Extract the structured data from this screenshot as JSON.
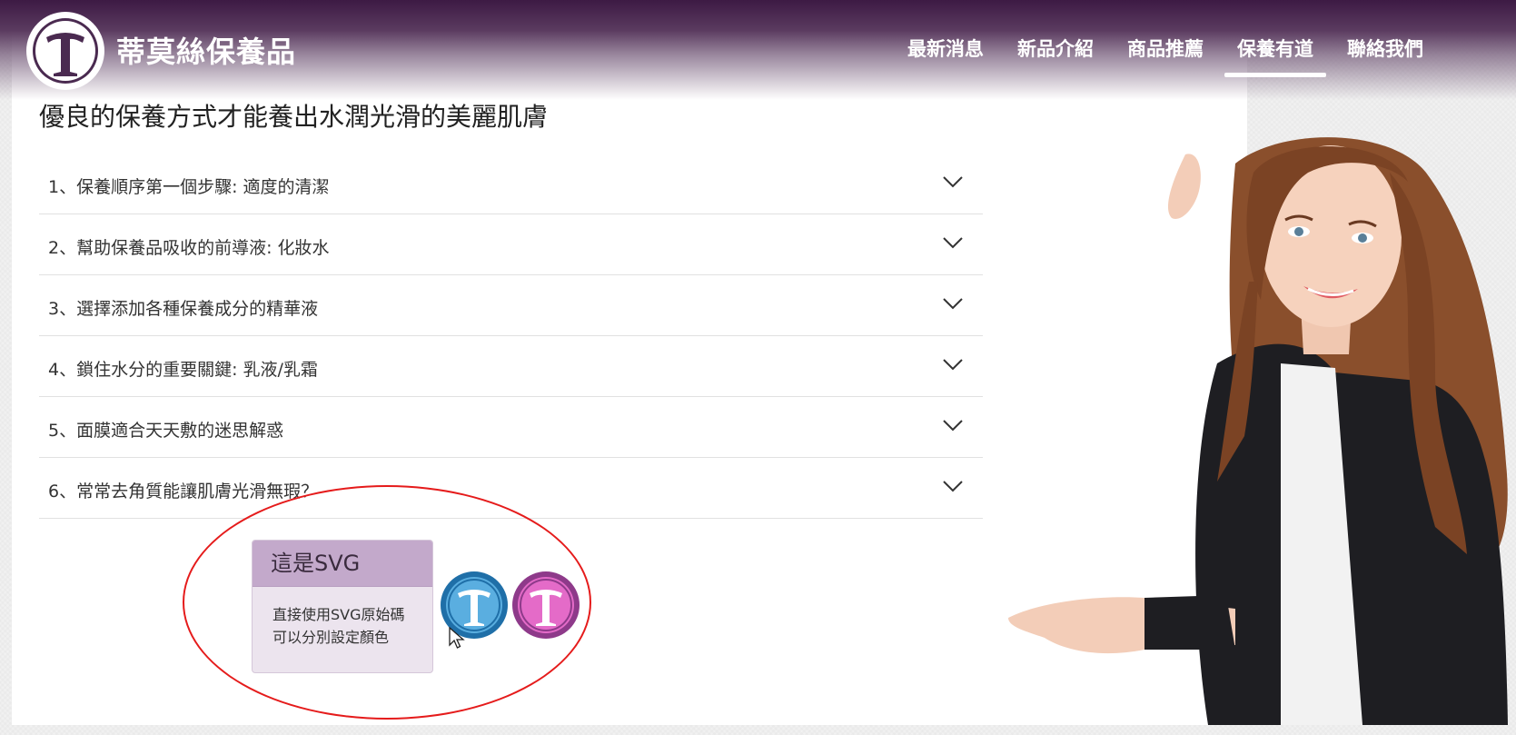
{
  "header": {
    "brand": "蒂莫絲保養品",
    "nav": [
      {
        "label": "最新消息",
        "active": false
      },
      {
        "label": "新品介紹",
        "active": false
      },
      {
        "label": "商品推薦",
        "active": false
      },
      {
        "label": "保養有道",
        "active": true
      },
      {
        "label": "聯絡我們",
        "active": false
      }
    ]
  },
  "main": {
    "title": "優良的保養方式才能養出水潤光滑的美麗肌膚",
    "accordion": [
      "1、保養順序第一個步驟: 適度的清潔",
      "2、幫助保養品吸收的前導液: 化妝水",
      "3、選擇添加各種保養成分的精華液",
      "4、鎖住水分的重要關鍵: 乳液/乳霜",
      "5、面膜適合天天敷的迷思解惑",
      "6、常常去角質能讓肌膚光滑無瑕？"
    ]
  },
  "svg_card": {
    "title": "這是SVG",
    "body_line1": "直接使用SVG原始碼",
    "body_line2": "可以分別設定顏色"
  },
  "colors": {
    "header_dark": "#3d1a44",
    "card_head": "#c3a9cb",
    "card_body": "#ece4ee",
    "logo_blue_ring": "#1f6fa8",
    "logo_blue_fill": "#5aaee0",
    "logo_purple_ring": "#8e3a8a",
    "logo_purple_fill": "#e46bc8",
    "ellipse": "#e51b1b"
  },
  "icons": {
    "brand_logo": "t-seal-logo-icon",
    "chevron": "chevron-down-icon",
    "cursor": "mouse-pointer-icon"
  }
}
